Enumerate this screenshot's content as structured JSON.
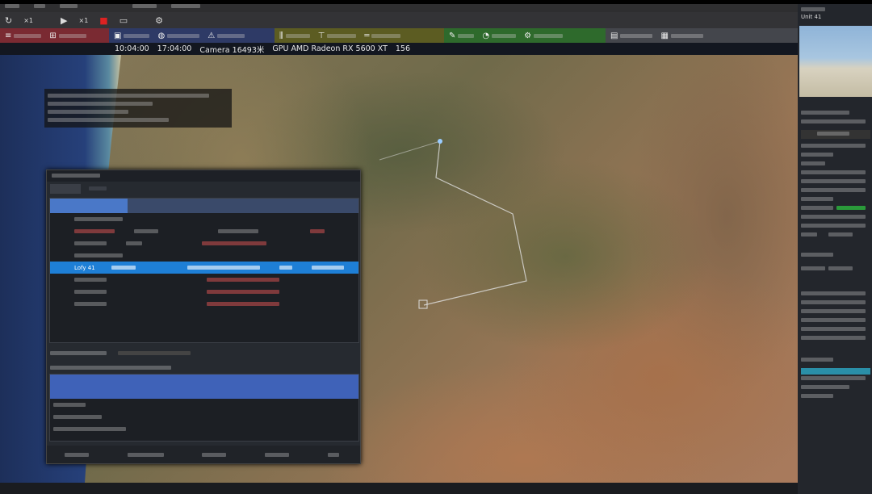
{
  "toolbar": {
    "speed1": "×1",
    "speed2": "×1"
  },
  "ribbon": {
    "colors": {
      "red": "#7a2a32",
      "blue": "#2e3a66",
      "olive": "#5c5c22",
      "green": "#2e6a2c",
      "gray": "#44464c"
    }
  },
  "status": {
    "items": [
      "10:04:00",
      "17:04:00",
      "Camera 16493米",
      "GPU AMD Radeon RX 5600 XT",
      "156"
    ]
  },
  "right_panel": {
    "title": "Unit 41"
  },
  "dialog": {
    "selected_row": "Lofy 41"
  },
  "map": {
    "route_color": "#e0e0e0"
  }
}
